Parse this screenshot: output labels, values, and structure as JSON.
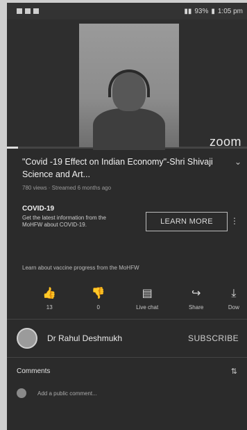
{
  "status_bar": {
    "battery": "93%",
    "time": "1:05 pm"
  },
  "video": {
    "overlay_label": "zoom"
  },
  "title": "\"Covid -19 Effect on Indian Economy\"-Shri Shivaji Science and Art...",
  "meta": "780 views · Streamed 6 months ago",
  "covid_card": {
    "heading": "COVID-19",
    "body": "Get the latest information from the MoHFW about COVID-19.",
    "button": "LEARN MORE"
  },
  "vaccine_text": "Learn about vaccine progress from the MoHFW",
  "actions": [
    {
      "icon": "thumbs-up-icon",
      "glyph": "👍",
      "label": "13"
    },
    {
      "icon": "thumbs-down-icon",
      "glyph": "👎",
      "label": "0"
    },
    {
      "icon": "live-chat-icon",
      "glyph": "▤",
      "label": "Live chat"
    },
    {
      "icon": "share-icon",
      "glyph": "↪",
      "label": "Share"
    },
    {
      "icon": "download-icon",
      "glyph": "⤓",
      "label": "Dow"
    }
  ],
  "channel": {
    "name": "Dr Rahul Deshmukh",
    "subscribe": "SUBSCRIBE"
  },
  "comments": {
    "title": "Comments",
    "placeholder": "Add a public comment..."
  }
}
